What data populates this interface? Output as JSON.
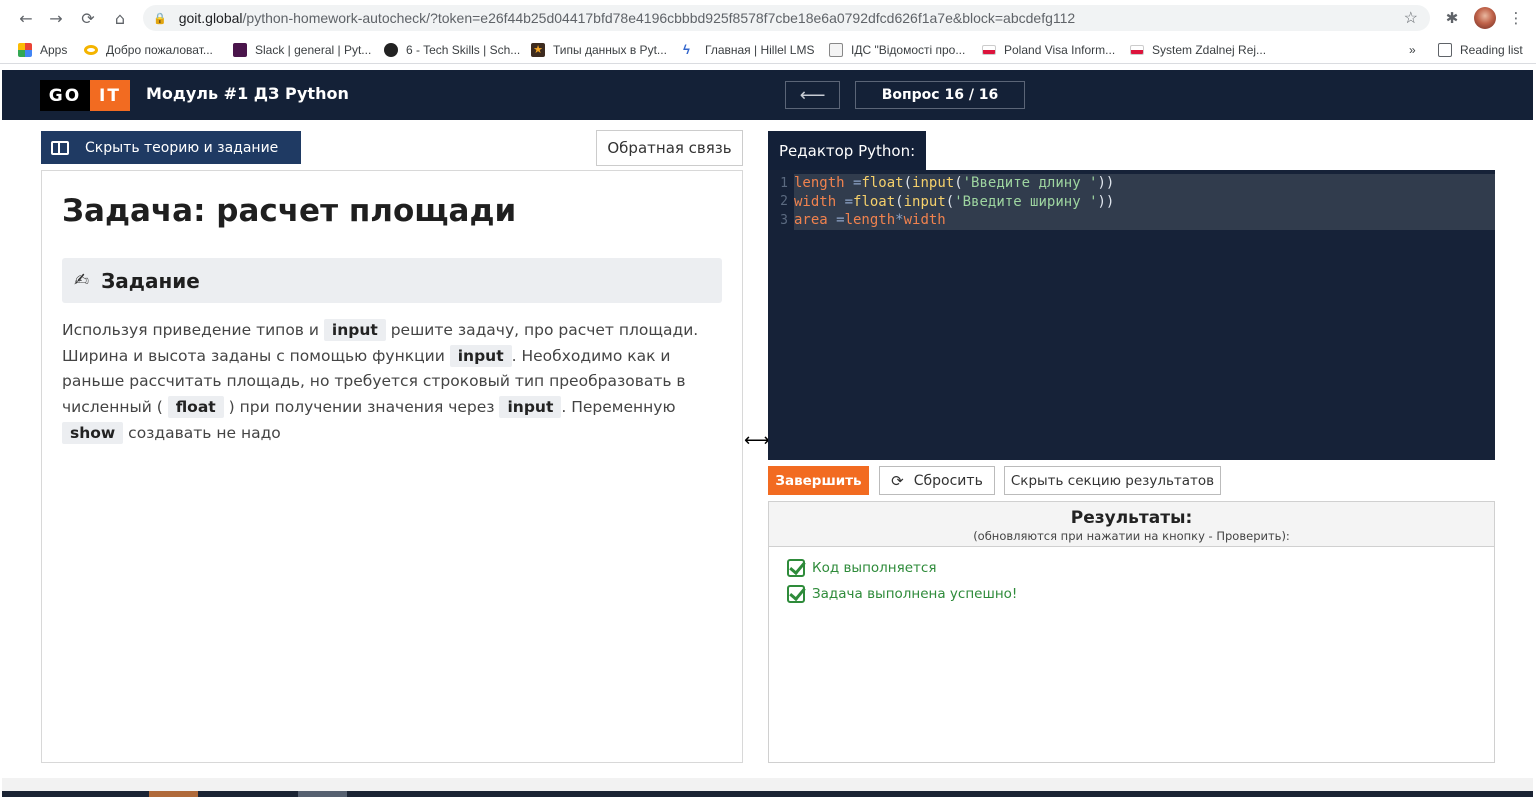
{
  "browser": {
    "url_host": "goit.global",
    "url_path": "/python-homework-autocheck/?token=e26f44b25d04417bfd78e4196cbbbd925f8578f7cbe18e6a0792dfcd626f1a7e&block=abcdefg112",
    "bookmarks": [
      {
        "label": "Apps",
        "icon": "apps-grid-icon",
        "color": "#ea4335"
      },
      {
        "label": "Добро пожаловат...",
        "icon": "goit-icon",
        "color": "#f4b400"
      },
      {
        "label": "Slack | general | Pyt...",
        "icon": "slack-icon",
        "color": "#4a154b"
      },
      {
        "label": "6 - Tech Skills | Sch...",
        "icon": "skype-icon",
        "color": "#222222"
      },
      {
        "label": "Типы данных в Pyt...",
        "icon": "star-badge-icon",
        "color": "#3d2b1f"
      },
      {
        "label": "Главная | Hillel LMS",
        "icon": "hillel-icon",
        "color": "#3366cc"
      },
      {
        "label": "ІДС \"Відомості про...",
        "icon": "document-icon",
        "color": "#888888"
      },
      {
        "label": "Poland Visa Inform...",
        "icon": "poland-flag-icon",
        "color": "#dc143c"
      },
      {
        "label": "System Zdalnej Rej...",
        "icon": "poland-flag-icon",
        "color": "#dc143c"
      }
    ],
    "more_label": "»",
    "reading_list": "Reading list"
  },
  "header": {
    "logo_go": "GO",
    "logo_it": "IT",
    "module_title": "Модуль #1 ДЗ Python",
    "back_arrow": "⟵",
    "question_label": "Вопрос 16 / 16"
  },
  "left": {
    "hide_button": "Скрыть теорию и задание",
    "feedback_button": "Обратная связь",
    "task_title": "Задача: расчет площади",
    "section_label": "Задание",
    "text": {
      "p1": "Используя приведение типов и",
      "c1": "input",
      "p2": "решите задачу, про расчет площади. Ширина и высота заданы с помощью функции",
      "c2": "input",
      "p3": ". Необходимо как и раньше рассчитать площадь, но требуется строковый тип преобразовать в численный (",
      "c3": "float",
      "p4": ") при получении значения через",
      "c4": "input",
      "p5": ". Переменную",
      "c5": "show",
      "p6": "создавать не надо"
    }
  },
  "editor": {
    "tab_label": "Редактор Python:",
    "lines": [
      {
        "n": "1",
        "var": "length",
        "op": " =",
        "fn1": "float",
        "fn2": "input",
        "str": "'Введите длину '"
      },
      {
        "n": "2",
        "var": "width",
        "op": " =",
        "fn1": "float",
        "fn2": "input",
        "str": "'Введите ширину '"
      },
      {
        "n": "3",
        "var": "area",
        "op": " =",
        "rhs": "length",
        "mul": "*",
        "rhs2": "width"
      }
    ]
  },
  "actions": {
    "finish": "Завершить",
    "reset": "Сбросить",
    "hide_results": "Скрыть секцию результатов"
  },
  "results": {
    "title": "Результаты:",
    "subtitle": "(обновляются при нажатии на кнопку - Проверить):",
    "items": [
      "Код выполняется",
      "Задача выполнена успешно!"
    ]
  },
  "colors": {
    "header_bg": "#142137",
    "accent_orange": "#f26b21",
    "button_blue": "#1f3a63",
    "success_green": "#2e8b3a"
  }
}
